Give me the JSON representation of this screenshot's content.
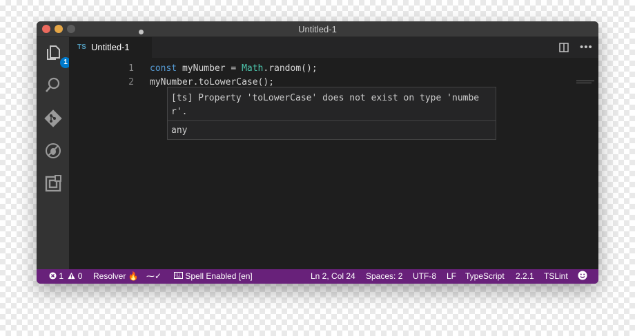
{
  "window": {
    "title": "Untitled-1"
  },
  "activity_bar": {
    "explorer_badge": "1"
  },
  "tab": {
    "lang": "TS",
    "title": "Untitled-1"
  },
  "editor": {
    "lines": [
      {
        "number": "1"
      },
      {
        "number": "2"
      }
    ],
    "line1": {
      "kw": "const",
      "a": " myNumber = ",
      "type": "Math",
      "b": ".random();"
    },
    "line2": {
      "obj": "myNumber.",
      "method": "toLowerCase",
      "rest": "();"
    }
  },
  "hover": {
    "message": "[ts] Property 'toLowerCase' does not exist on type 'number'.",
    "type": "any"
  },
  "status_bar": {
    "errors": "1",
    "warnings": "0",
    "resolver": "Resolver",
    "spell": "Spell Enabled [en]",
    "position": "Ln 2, Col 24",
    "spaces": "Spaces: 2",
    "encoding": "UTF-8",
    "eol": "LF",
    "language": "TypeScript",
    "version": "2.2.1",
    "linter": "TSLint"
  },
  "colors": {
    "status_bar": "#68217a",
    "editor_bg": "#1e1e1e",
    "activity_bar": "#333333",
    "error": "#e51400"
  }
}
